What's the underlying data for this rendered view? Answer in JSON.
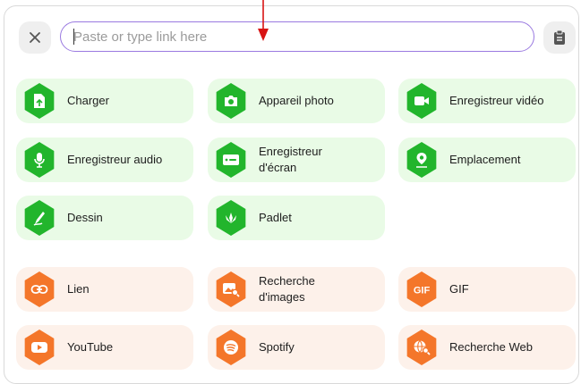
{
  "input": {
    "placeholder": "Paste or type link here"
  },
  "icons": {
    "close": "close-icon",
    "paste": "clipboard-icon"
  },
  "colors": {
    "green": "#22b52c",
    "green_bg": "#e9fbe6",
    "orange": "#f4762a",
    "orange_bg": "#fdf1ea",
    "focus": "#9a7ae0",
    "arrow": "#d81414"
  },
  "tiles": [
    {
      "label": "Charger",
      "icon": "upload-file-icon"
    },
    {
      "label": "Appareil photo",
      "icon": "camera-icon"
    },
    {
      "label": "Enregistreur vidéo",
      "icon": "video-camera-icon"
    },
    {
      "label": "Enregistreur audio",
      "icon": "microphone-icon"
    },
    {
      "label": "Enregistreur\nd'écran",
      "icon": "screen-recorder-icon"
    },
    {
      "label": "Emplacement",
      "icon": "map-pin-icon"
    },
    {
      "label": "Dessin",
      "icon": "drawing-icon"
    },
    {
      "label": "Padlet",
      "icon": "padlet-icon"
    },
    {
      "label": "Lien",
      "icon": "link-icon"
    },
    {
      "label": "Recherche\nd'images",
      "icon": "image-search-icon"
    },
    {
      "label": "GIF",
      "icon": "gif-icon"
    },
    {
      "label": "YouTube",
      "icon": "youtube-icon"
    },
    {
      "label": "Spotify",
      "icon": "spotify-icon"
    },
    {
      "label": "Recherche Web",
      "icon": "web-search-icon"
    }
  ]
}
